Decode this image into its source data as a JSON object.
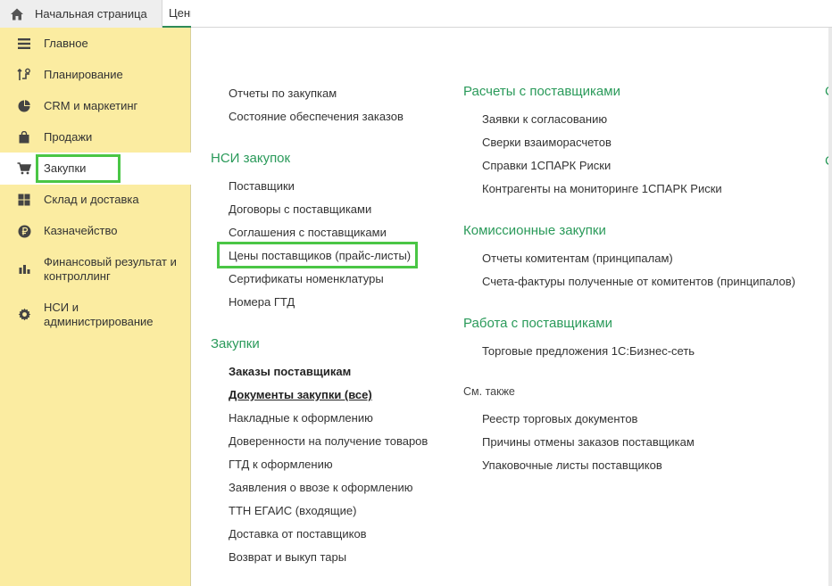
{
  "tabs": {
    "home_label": "Начальная страница",
    "open_tab_label": "Цены поставщиков"
  },
  "sidebar": {
    "items": [
      {
        "label": "Главное",
        "icon": "menu-icon"
      },
      {
        "label": "Планирование",
        "icon": "planning-icon"
      },
      {
        "label": "CRM и маркетинг",
        "icon": "pie-chart-icon"
      },
      {
        "label": "Продажи",
        "icon": "shopping-bag-icon"
      },
      {
        "label": "Закупки",
        "icon": "cart-icon"
      },
      {
        "label": "Склад и доставка",
        "icon": "warehouse-icon"
      },
      {
        "label": "Казначейство",
        "icon": "ruble-coin-icon"
      },
      {
        "label": "Финансовый результат и контроллинг",
        "icon": "bar-chart-icon"
      },
      {
        "label": "НСИ и администрирование",
        "icon": "gear-icon"
      }
    ]
  },
  "content": {
    "col1": {
      "top_links": [
        "Отчеты по закупкам",
        "Состояние обеспечения заказов"
      ],
      "nsi": {
        "title": "НСИ закупок",
        "links": [
          "Поставщики",
          "Договоры с поставщиками",
          "Соглашения с поставщиками",
          "Цены поставщиков (прайс-листы)",
          "Сертификаты номенклатуры",
          "Номера ГТД"
        ]
      },
      "purchases": {
        "title": "Закупки",
        "links": [
          "Заказы поставщикам",
          "Документы закупки (все)",
          "Накладные к оформлению",
          "Доверенности на получение товаров",
          "ГТД к оформлению",
          "Заявления о ввозе к оформлению",
          "ТТН ЕГАИС (входящие)",
          "Доставка от поставщиков",
          "Возврат и выкуп тары"
        ]
      }
    },
    "col2": {
      "settlements": {
        "title": "Расчеты с поставщиками",
        "links": [
          "Заявки к согласованию",
          "Сверки взаиморасчетов",
          "Справки 1СПАРК Риски",
          "Контрагенты на мониторинге 1СПАРК Риски"
        ]
      },
      "commission": {
        "title": "Комиссионные закупки",
        "links": [
          "Отчеты комитентам (принципалам)",
          "Счета-фактуры полученные от комитентов (принципалов)"
        ]
      },
      "work": {
        "title": "Работа с поставщиками",
        "links": [
          "Торговые предложения 1С:Бизнес-сеть"
        ]
      },
      "see_also": {
        "title": "См. также",
        "links": [
          "Реестр торговых документов",
          "Причины отмены заказов поставщикам",
          "Упаковочные листы поставщиков"
        ]
      }
    },
    "col3_cut": [
      "С",
      "С"
    ]
  },
  "colors": {
    "sidebar_bg": "#fbeca1",
    "group_title": "#2a9a5a",
    "highlight": "#4ac645"
  }
}
